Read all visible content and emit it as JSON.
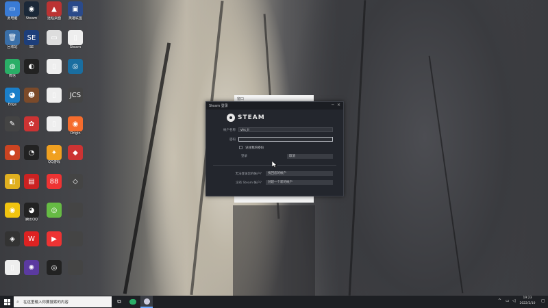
{
  "desktop": {
    "icons": [
      {
        "label": "此电脑",
        "color": "#3a7bd5",
        "glyph": "▭"
      },
      {
        "label": "Steam",
        "color": "#1b2838",
        "glyph": "◉"
      },
      {
        "label": "远程桌面",
        "color": "#b33",
        "glyph": "▲"
      },
      {
        "label": "英雄联盟",
        "color": "#2b4a8a",
        "glyph": "▣"
      },
      {
        "label": "回收站",
        "color": "#3a6fa8",
        "glyph": "🗑"
      },
      {
        "label": "SE",
        "color": "#1d3e7a",
        "glyph": "SE"
      },
      {
        "label": "",
        "color": "#ddd",
        "glyph": "▭"
      },
      {
        "label": "Steam",
        "color": "#eee",
        "glyph": "▯"
      },
      {
        "label": "微信",
        "color": "#2aae67",
        "glyph": "◍"
      },
      {
        "label": "",
        "color": "#222",
        "glyph": "◐"
      },
      {
        "label": "",
        "color": "#eee",
        "glyph": "▯"
      },
      {
        "label": "",
        "color": "#1a6ea0",
        "glyph": "◎"
      },
      {
        "label": "Edge",
        "color": "#1b7fc9",
        "glyph": "◕"
      },
      {
        "label": "",
        "color": "#7b4a2a",
        "glyph": "☻"
      },
      {
        "label": "",
        "color": "#eee",
        "glyph": "▯"
      },
      {
        "label": "",
        "color": "#444",
        "glyph": "JCS"
      },
      {
        "label": "",
        "color": "#444",
        "glyph": "✎"
      },
      {
        "label": "",
        "color": "#c33",
        "glyph": "✿"
      },
      {
        "label": "",
        "color": "#eee",
        "glyph": "▯"
      },
      {
        "label": "Origin",
        "color": "#f56c2d",
        "glyph": "◉"
      },
      {
        "label": "",
        "color": "#c42",
        "glyph": "●"
      },
      {
        "label": "",
        "color": "#222",
        "glyph": "◔"
      },
      {
        "label": "QQ游戏",
        "color": "#f0a020",
        "glyph": "✦"
      },
      {
        "label": "",
        "color": "#c33",
        "glyph": "◆"
      },
      {
        "label": "",
        "color": "#e0b020",
        "glyph": "◧"
      },
      {
        "label": "",
        "color": "#c22",
        "glyph": "▤"
      },
      {
        "label": "",
        "color": "#e33",
        "glyph": "88"
      },
      {
        "label": "",
        "color": "#444",
        "glyph": "◇"
      },
      {
        "label": "",
        "color": "#f1c40f",
        "glyph": "◉"
      },
      {
        "label": "腾讯QQ",
        "color": "#222",
        "glyph": "◕"
      },
      {
        "label": "",
        "color": "#6b4",
        "glyph": "◎"
      },
      {
        "label": "",
        "color": "#444",
        "glyph": ""
      },
      {
        "label": "",
        "color": "#333",
        "glyph": "◈"
      },
      {
        "label": "",
        "color": "#d22",
        "glyph": "W"
      },
      {
        "label": "",
        "color": "#e33",
        "glyph": "▶"
      },
      {
        "label": "",
        "color": "#444",
        "glyph": ""
      },
      {
        "label": "",
        "color": "#eee",
        "glyph": "▯"
      },
      {
        "label": "",
        "color": "#5b3aa0",
        "glyph": "✺"
      },
      {
        "label": "",
        "color": "#222",
        "glyph": "◎"
      },
      {
        "label": "",
        "color": "#444",
        "glyph": ""
      }
    ]
  },
  "background_window": {
    "title": "窗口"
  },
  "steam_dialog": {
    "title": "Steam 登录",
    "logo_text": "STEAM",
    "account_label": "帐户名称",
    "account_value": "vhs_ll",
    "password_label": "密码",
    "password_value": "",
    "remember_label": "记住我的密码",
    "login_label": "登录",
    "cancel_label": "取消",
    "forgot_prompt": "无法登录您的帐户？",
    "forgot_button": "找回您的帐户",
    "create_prompt": "没有 Steam 帐户？",
    "create_button": "创建一个新的帐户"
  },
  "taskbar": {
    "search_placeholder": "在这里输入你要搜索的内容",
    "time": "19:23",
    "date": "2022/2/10"
  }
}
